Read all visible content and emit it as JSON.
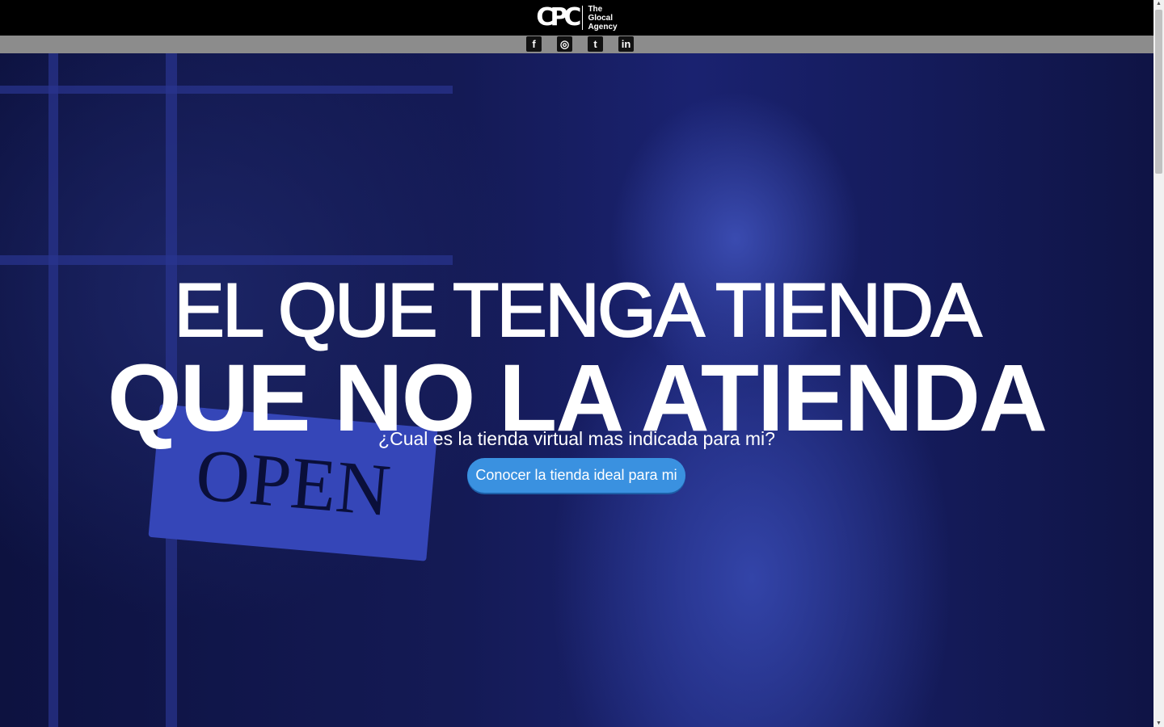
{
  "header": {
    "logo_mark": "CPC",
    "logo_lines": [
      "The",
      "Glocal",
      "Agency"
    ]
  },
  "social": [
    {
      "name": "facebook",
      "glyph": "f"
    },
    {
      "name": "instagram",
      "glyph": "◎"
    },
    {
      "name": "twitter",
      "glyph": "t"
    },
    {
      "name": "linkedin",
      "glyph": "in"
    }
  ],
  "hero": {
    "line1": "EL QUE TENGA TIENDA",
    "line2": "QUE NO LA ATIENDA",
    "subtitle": "¿Cual es la tienda virtual mas indicada para mi?",
    "cta_label": "Conocer la tienda ideal para mi",
    "sign_text": "OPEN"
  },
  "colors": {
    "cta": "#3a91e0",
    "overlay": "#141a55"
  }
}
